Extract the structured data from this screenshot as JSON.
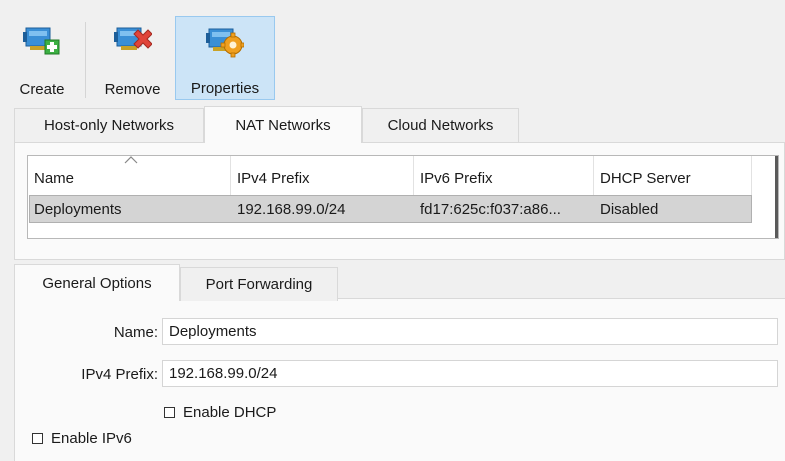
{
  "toolbar": {
    "create_label": "Create",
    "remove_label": "Remove",
    "properties_label": "Properties"
  },
  "network_tabs": [
    {
      "label": "Host-only Networks",
      "selected": false
    },
    {
      "label": "NAT Networks",
      "selected": true
    },
    {
      "label": "Cloud Networks",
      "selected": false
    }
  ],
  "table": {
    "columns": [
      "Name",
      "IPv4 Prefix",
      "IPv6 Prefix",
      "DHCP Server"
    ],
    "sorted_column": "Name",
    "rows": [
      {
        "name": "Deployments",
        "ipv4": "192.168.99.0/24",
        "ipv6": "fd17:625c:f037:a86...",
        "dhcp": "Disabled",
        "selected": true
      }
    ]
  },
  "detail_tabs": [
    {
      "label": "General Options",
      "selected": true
    },
    {
      "label": "Port Forwarding",
      "selected": false
    }
  ],
  "form": {
    "name_label": "Name:",
    "name_value": "Deployments",
    "ipv4_label": "IPv4 Prefix:",
    "ipv4_value": "192.168.99.0/24",
    "enable_dhcp_label": "Enable DHCP",
    "enable_dhcp_checked": false,
    "enable_ipv6_label": "Enable IPv6",
    "enable_ipv6_checked": false
  },
  "colors": {
    "selected_row": "#d4d4d4",
    "active_tool": "#cce4f7",
    "accent_green": "#3cb043",
    "accent_red": "#e0443a",
    "accent_orange": "#f0a020",
    "icon_blue": "#3a8fd6"
  }
}
